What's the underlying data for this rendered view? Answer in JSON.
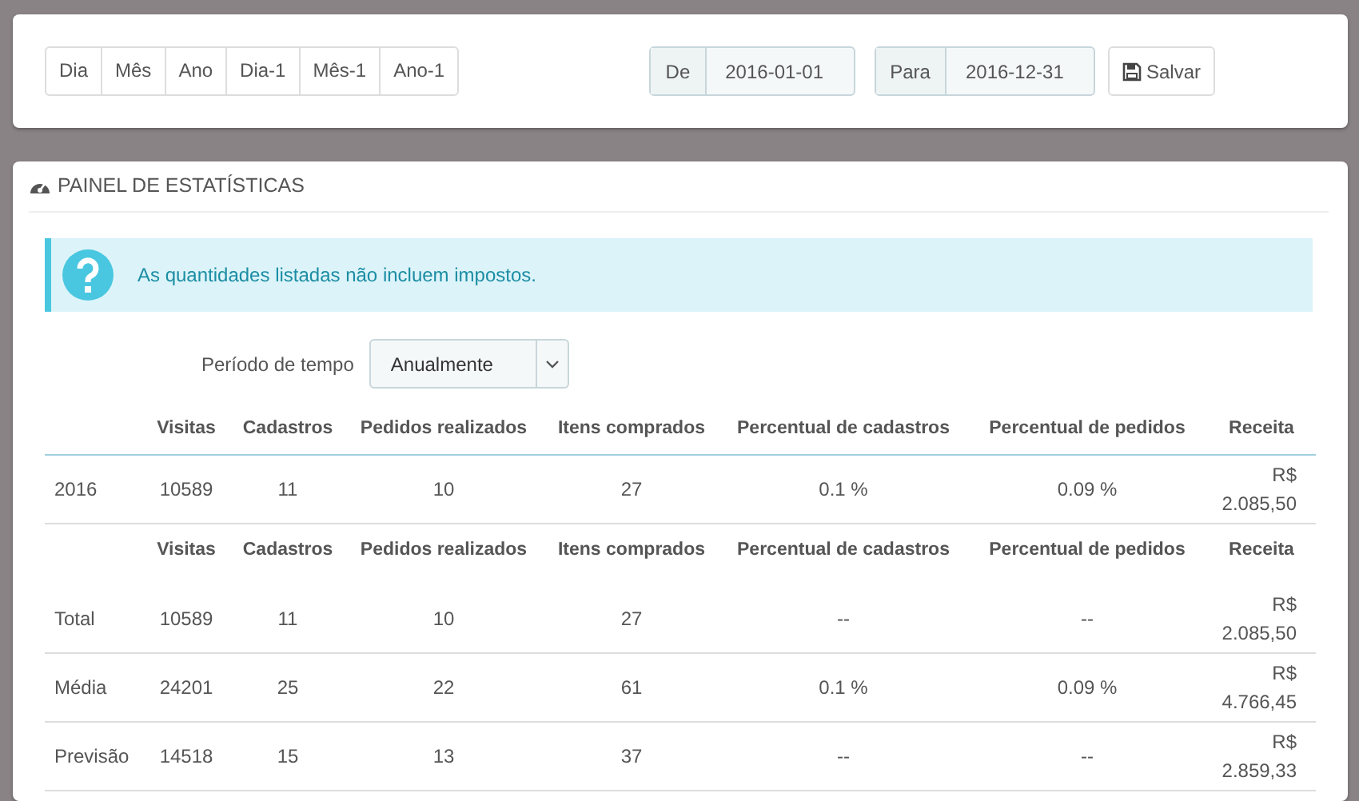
{
  "range_buttons": [
    "Dia",
    "Mês",
    "Ano",
    "Dia-1",
    "Mês-1",
    "Ano-1"
  ],
  "date_from": {
    "label": "De",
    "value": "2016-01-01"
  },
  "date_to": {
    "label": "Para",
    "value": "2016-12-31"
  },
  "save_button": "Salvar",
  "panel": {
    "title": "PAINEL DE ESTATÍSTICAS",
    "alert": "As quantidades listadas não incluem impostos.",
    "period": {
      "label": "Período de tempo",
      "value": "Anualmente"
    },
    "table": {
      "columns": [
        "",
        "Visitas",
        "Cadastros",
        "Pedidos realizados",
        "Itens comprados",
        "Percentual de cadastros",
        "Percentual de pedidos",
        "Receita"
      ],
      "rows": [
        [
          "2016",
          "10589",
          "11",
          "10",
          "27",
          "0.1 %",
          "0.09 %",
          "R$ 2.085,50"
        ]
      ]
    },
    "summary": {
      "columns": [
        "",
        "Visitas",
        "Cadastros",
        "Pedidos realizados",
        "Itens comprados",
        "Percentual de cadastros",
        "Percentual de pedidos",
        "Receita"
      ],
      "rows": [
        [
          "Total",
          "10589",
          "11",
          "10",
          "27",
          "--",
          "--",
          "R$ 2.085,50"
        ],
        [
          "Média",
          "24201",
          "25",
          "22",
          "61",
          "0.1 %",
          "0.09 %",
          "R$ 4.766,45"
        ],
        [
          "Previsão",
          "14518",
          "15",
          "13",
          "37",
          "--",
          "--",
          "R$ 2.859,33"
        ]
      ]
    }
  }
}
